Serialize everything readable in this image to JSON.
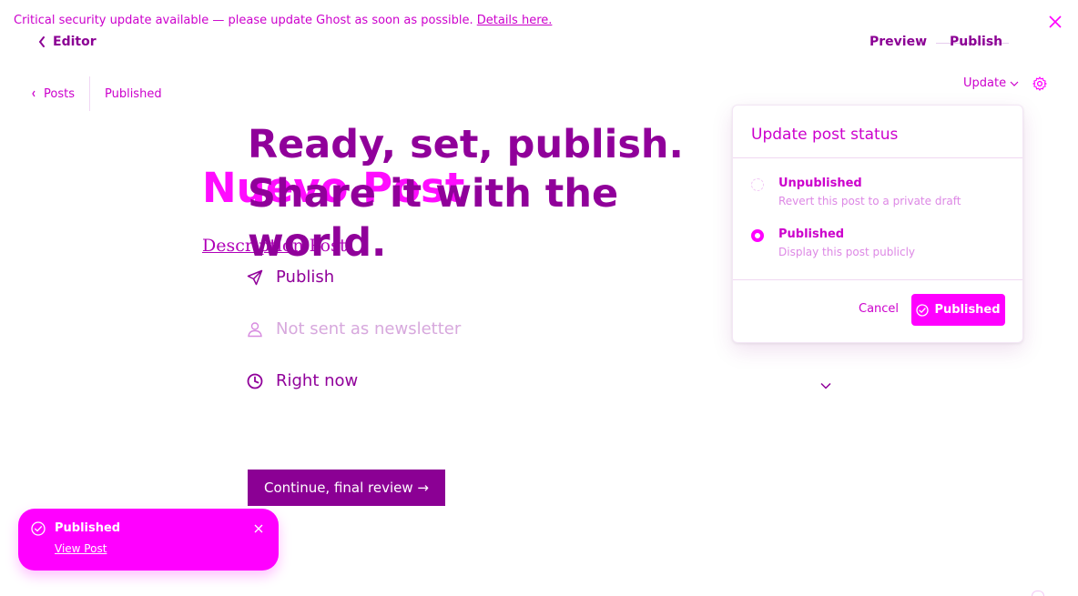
{
  "banner": {
    "message": "Critical security update available — please update Ghost as soon as possible.",
    "link_text": "Details here.",
    "close_icon": "close-icon"
  },
  "top_nav": {
    "back_label": "Editor",
    "preview_label": "Preview",
    "publish_label": "Publish"
  },
  "breadcrumbs": {
    "posts_label": "Posts",
    "status_label": "Published"
  },
  "toolbar": {
    "update_label": "Update",
    "settings_icon": "gear-icon"
  },
  "draft_post": {
    "title": "Nuevo Post",
    "description_underlined": "Description",
    "description_rest": "Post"
  },
  "publish_flow": {
    "headline_line1": "Ready, set, publish.",
    "headline_line2": "Share it with the world.",
    "options": [
      {
        "icon": "send-icon",
        "label": "Publish"
      },
      {
        "icon": "user-icon",
        "label": "Not sent as newsletter"
      },
      {
        "icon": "clock-icon",
        "label": "Right now"
      }
    ],
    "continue_label": "Continue, final review →"
  },
  "status_panel": {
    "title": "Update post status",
    "options": [
      {
        "label": "Unpublished",
        "description": "Revert this post to a private draft",
        "selected": false
      },
      {
        "label": "Published",
        "description": "Display this post publicly",
        "selected": true
      }
    ],
    "cancel_label": "Cancel",
    "confirm_label": "Published"
  },
  "toast": {
    "title": "Published",
    "link_text": "View Post"
  },
  "colors": {
    "accent": "#ff00ff",
    "dark_accent": "#8b0094",
    "text_accent": "#cc00cc"
  }
}
